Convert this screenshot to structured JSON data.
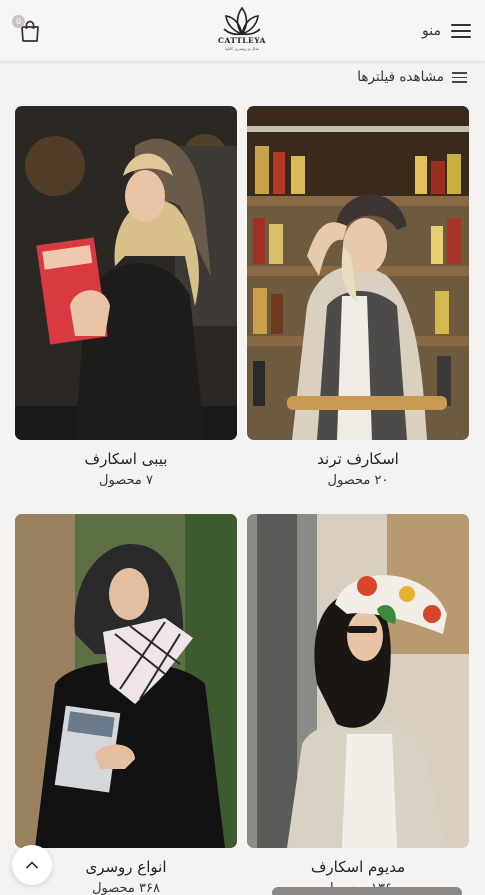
{
  "header": {
    "menu_label": "منو",
    "logo_text": "CATTLEYA",
    "logo_subtext": "شال و روسری کاتلیا",
    "cart_count": "0"
  },
  "filters": {
    "label": "مشاهده فیلترها"
  },
  "categories": [
    {
      "title": "اسکارف ترند",
      "count": "۲۰ محصول"
    },
    {
      "title": "بیبی اسکارف",
      "count": "۷ محصول"
    },
    {
      "title": "مدیوم اسکارف",
      "count": "۱۳۶ محصول"
    },
    {
      "title": "انواع روسری",
      "count": "۳۶۸ محصول"
    }
  ],
  "colors": {
    "background": "#f5f3f2",
    "header": "#f7f6f5"
  },
  "icons": [
    "hamburger-icon",
    "cart-icon",
    "filter-lines-icon",
    "chevron-up-icon"
  ]
}
